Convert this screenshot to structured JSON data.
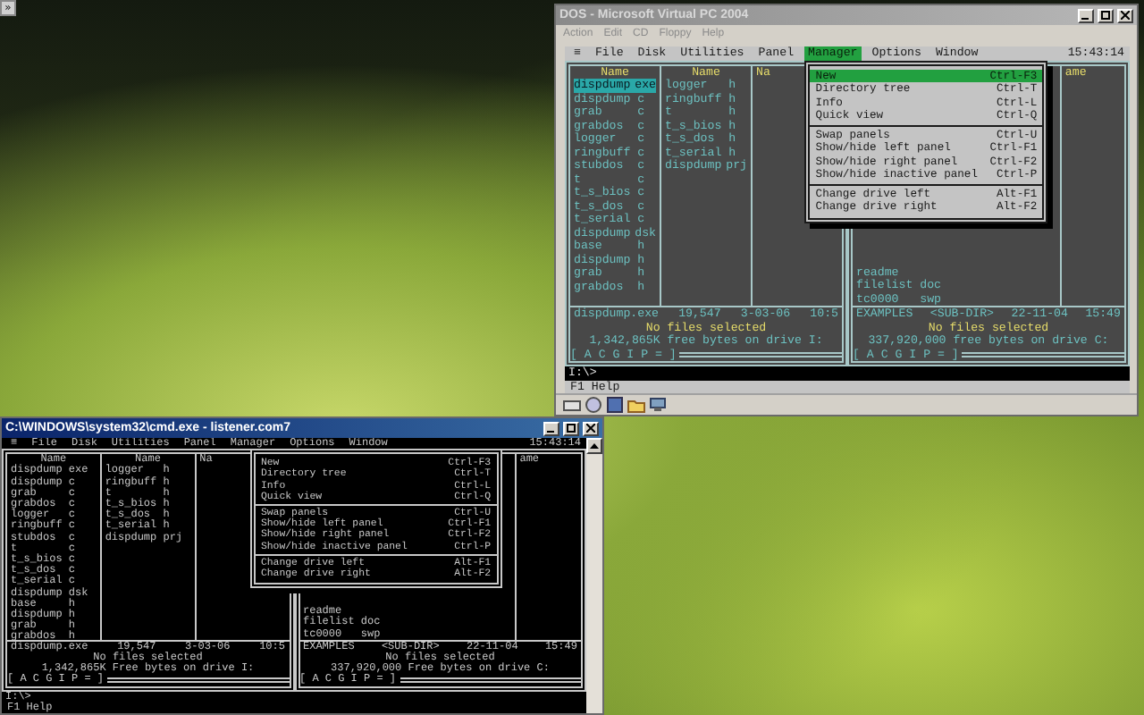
{
  "desktop": {
    "corner_button": "»"
  },
  "windows": [
    {
      "kind": "vpc",
      "active": false,
      "title": "DOS - Microsoft Virtual PC 2004",
      "menu": [
        "Action",
        "Edit",
        "CD",
        "Floppy",
        "Help"
      ],
      "screen": {
        "menu": [
          {
            "label": "≡",
            "selected": false
          },
          {
            "label": "File",
            "selected": false
          },
          {
            "label": "Disk",
            "selected": false
          },
          {
            "label": "Utilities",
            "selected": false
          },
          {
            "label": "Panel",
            "selected": false
          },
          {
            "label": "Manager",
            "selected": true
          },
          {
            "label": "Options",
            "selected": false
          },
          {
            "label": "Window",
            "selected": false
          }
        ],
        "clock": "15:43:14",
        "left_panel": {
          "columns": [
            {
              "header": "Name",
              "files": [
                {
                  "name": "dispdump",
                  "ext": "exe",
                  "selected": true
                },
                {
                  "name": "dispdump",
                  "ext": "c",
                  "selected": false
                },
                {
                  "name": "grab",
                  "ext": "c",
                  "selected": false
                },
                {
                  "name": "grabdos",
                  "ext": "c",
                  "selected": false
                },
                {
                  "name": "logger",
                  "ext": "c",
                  "selected": false
                },
                {
                  "name": "ringbuff",
                  "ext": "c",
                  "selected": false
                },
                {
                  "name": "stubdos",
                  "ext": "c",
                  "selected": false
                },
                {
                  "name": "t",
                  "ext": "c",
                  "selected": false
                },
                {
                  "name": "t_s_bios",
                  "ext": "c",
                  "selected": false
                },
                {
                  "name": "t_s_dos",
                  "ext": "c",
                  "selected": false
                },
                {
                  "name": "t_serial",
                  "ext": "c",
                  "selected": false
                },
                {
                  "name": "dispdump",
                  "ext": "dsk",
                  "selected": false
                },
                {
                  "name": "base",
                  "ext": "h",
                  "selected": false
                },
                {
                  "name": "dispdump",
                  "ext": "h",
                  "selected": false
                },
                {
                  "name": "grab",
                  "ext": "h",
                  "selected": false
                },
                {
                  "name": "grabdos",
                  "ext": "h",
                  "selected": false
                }
              ]
            },
            {
              "header": "Name",
              "files": [
                {
                  "name": "logger",
                  "ext": "h",
                  "selected": false
                },
                {
                  "name": "ringbuff",
                  "ext": "h",
                  "selected": false
                },
                {
                  "name": "t",
                  "ext": "h",
                  "selected": false
                },
                {
                  "name": "t_s_bios",
                  "ext": "h",
                  "selected": false
                },
                {
                  "name": "t_s_dos",
                  "ext": "h",
                  "selected": false
                },
                {
                  "name": "t_serial",
                  "ext": "h",
                  "selected": false
                },
                {
                  "name": "dispdump",
                  "ext": "prj",
                  "selected": false
                }
              ]
            },
            {
              "header": "Na"
            }
          ],
          "current": {
            "name": "dispdump.exe",
            "size": "19,547",
            "date": "3-03-06",
            "time": "10:5"
          },
          "selection": "No files selected",
          "free": "1,342,865K free bytes on drive I:",
          "drives": "[ A C G I P = ]"
        },
        "right_panel": {
          "columns": [
            {
              "files": [
                {
                  "name": "readme",
                  "selected": false
                },
                {
                  "name": "filelist",
                  "ext": "doc",
                  "selected": false
                },
                {
                  "name": "tc0000",
                  "ext": "swp",
                  "selected": false
                }
              ]
            },
            {
              "header": "ame"
            }
          ],
          "current": {
            "name": "EXAMPLES",
            "size": "<SUB-DIR>",
            "date": "22-11-04",
            "time": "15:49"
          },
          "selection": "No files selected",
          "free": "337,920,000 free bytes on drive C:",
          "drives": "[ A C G I P = ]"
        },
        "dropdown": {
          "groups": [
            {
              "items": [
                {
                  "label": "New",
                  "shortcut": "Ctrl-F3",
                  "selected": true
                },
                {
                  "label": "Directory tree",
                  "shortcut": "Ctrl-T",
                  "selected": false
                },
                {
                  "label": "Info",
                  "shortcut": "Ctrl-L",
                  "selected": false
                },
                {
                  "label": "Quick view",
                  "shortcut": "Ctrl-Q",
                  "selected": false
                }
              ]
            },
            {
              "items": [
                {
                  "label": "Swap panels",
                  "shortcut": "Ctrl-U",
                  "selected": false
                },
                {
                  "label": "Show/hide left panel",
                  "shortcut": "Ctrl-F1",
                  "selected": false
                },
                {
                  "label": "Show/hide right panel",
                  "shortcut": "Ctrl-F2",
                  "selected": false
                },
                {
                  "label": "Show/hide inactive panel",
                  "shortcut": "Ctrl-P",
                  "selected": false
                }
              ]
            },
            {
              "items": [
                {
                  "label": "Change drive left",
                  "shortcut": "Alt-F1",
                  "selected": false
                },
                {
                  "label": "Change drive right",
                  "shortcut": "Alt-F2",
                  "selected": false
                }
              ]
            }
          ]
        },
        "prompt": "I:\\>",
        "keybar": "F1 Help"
      }
    },
    {
      "kind": "console",
      "active": true,
      "title": "C:\\WINDOWS\\system32\\cmd.exe - listener.com7",
      "screen": {
        "menu": [
          {
            "label": "≡",
            "selected": false
          },
          {
            "label": "File",
            "selected": false
          },
          {
            "label": "Disk",
            "selected": false
          },
          {
            "label": "Utilities",
            "selected": false
          },
          {
            "label": "Panel",
            "selected": false
          },
          {
            "label": "Manager",
            "selected": false
          },
          {
            "label": "Options",
            "selected": false
          },
          {
            "label": "Window",
            "selected": false
          }
        ],
        "clock": "15:43:14",
        "left_panel": {
          "columns": [
            {
              "header": "Name",
              "files": [
                {
                  "name": "dispdump",
                  "ext": "exe",
                  "selected": false
                },
                {
                  "name": "dispdump",
                  "ext": "c",
                  "selected": false
                },
                {
                  "name": "grab",
                  "ext": "c",
                  "selected": false
                },
                {
                  "name": "grabdos",
                  "ext": "c",
                  "selected": false
                },
                {
                  "name": "logger",
                  "ext": "c",
                  "selected": false
                },
                {
                  "name": "ringbuff",
                  "ext": "c",
                  "selected": false
                },
                {
                  "name": "stubdos",
                  "ext": "c",
                  "selected": false
                },
                {
                  "name": "t",
                  "ext": "c",
                  "selected": false
                },
                {
                  "name": "t_s_bios",
                  "ext": "c",
                  "selected": false
                },
                {
                  "name": "t_s_dos",
                  "ext": "c",
                  "selected": false
                },
                {
                  "name": "t_serial",
                  "ext": "c",
                  "selected": false
                },
                {
                  "name": "dispdump",
                  "ext": "dsk",
                  "selected": false
                },
                {
                  "name": "base",
                  "ext": "h",
                  "selected": false
                },
                {
                  "name": "dispdump",
                  "ext": "h",
                  "selected": false
                },
                {
                  "name": "grab",
                  "ext": "h",
                  "selected": false
                },
                {
                  "name": "grabdos",
                  "ext": "h",
                  "selected": false
                }
              ]
            },
            {
              "header": "Name",
              "files": [
                {
                  "name": "logger",
                  "ext": "h",
                  "selected": false
                },
                {
                  "name": "ringbuff",
                  "ext": "h",
                  "selected": false
                },
                {
                  "name": "t",
                  "ext": "h",
                  "selected": false
                },
                {
                  "name": "t_s_bios",
                  "ext": "h",
                  "selected": false
                },
                {
                  "name": "t_s_dos",
                  "ext": "h",
                  "selected": false
                },
                {
                  "name": "t_serial",
                  "ext": "h",
                  "selected": false
                },
                {
                  "name": "dispdump",
                  "ext": "prj",
                  "selected": false
                }
              ]
            },
            {
              "header": "Na"
            }
          ],
          "current": {
            "name": "dispdump.exe",
            "size": "19,547",
            "date": "3-03-06",
            "time": "10:5"
          },
          "selection": "No files selected",
          "free": "1,342,865K Free bytes on drive I:",
          "drives": "[ A C G I P = ]"
        },
        "right_panel": {
          "columns": [
            {
              "files": [
                {
                  "name": "readme",
                  "selected": false
                },
                {
                  "name": "filelist",
                  "ext": "doc",
                  "selected": false
                },
                {
                  "name": "tc0000",
                  "ext": "swp",
                  "selected": false
                }
              ]
            },
            {
              "header": "ame"
            }
          ],
          "current": {
            "name": "EXAMPLES",
            "size": "<SUB-DIR>",
            "date": "22-11-04",
            "time": "15:49"
          },
          "selection": "No files selected",
          "free": "337,920,000 Free bytes on drive C:",
          "drives": "[ A C G I P = ]"
        },
        "dropdown": {
          "groups": [
            {
              "items": [
                {
                  "label": "New",
                  "shortcut": "Ctrl-F3",
                  "selected": false
                },
                {
                  "label": "Directory tree",
                  "shortcut": "Ctrl-T",
                  "selected": false
                },
                {
                  "label": "Info",
                  "shortcut": "Ctrl-L",
                  "selected": false
                },
                {
                  "label": "Quick view",
                  "shortcut": "Ctrl-Q",
                  "selected": false
                }
              ]
            },
            {
              "items": [
                {
                  "label": "Swap panels",
                  "shortcut": "Ctrl-U",
                  "selected": false
                },
                {
                  "label": "Show/hide left panel",
                  "shortcut": "Ctrl-F1",
                  "selected": false
                },
                {
                  "label": "Show/hide right panel",
                  "shortcut": "Ctrl-F2",
                  "selected": false
                },
                {
                  "label": "Show/hide inactive panel",
                  "shortcut": "Ctrl-P",
                  "selected": false
                }
              ]
            },
            {
              "items": [
                {
                  "label": "Change drive left",
                  "shortcut": "Alt-F1",
                  "selected": false
                },
                {
                  "label": "Change drive right",
                  "shortcut": "Alt-F2",
                  "selected": false
                }
              ]
            }
          ]
        },
        "prompt": "I:\\>",
        "keybar": "F1 Help"
      }
    }
  ]
}
